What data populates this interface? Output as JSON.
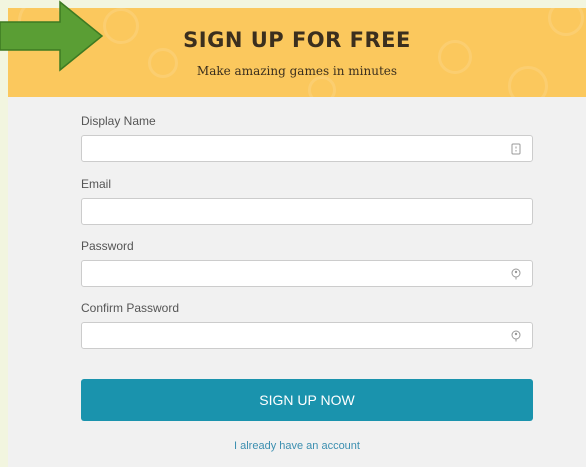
{
  "header": {
    "title": "SIGN UP FOR FREE",
    "subtitle": "Make amazing games in minutes",
    "background_color": "#fbc85d"
  },
  "form": {
    "display_name": {
      "label": "Display Name",
      "value": "",
      "icon": "id-card-icon"
    },
    "email": {
      "label": "Email",
      "value": ""
    },
    "password": {
      "label": "Password",
      "value": "",
      "icon": "key-icon"
    },
    "confirm_password": {
      "label": "Confirm Password",
      "value": "",
      "icon": "key-icon"
    },
    "submit_label": "SIGN UP NOW",
    "login_link": "I already have an account"
  },
  "colors": {
    "accent": "#1a93ad",
    "arrow": "#5a9e34"
  }
}
